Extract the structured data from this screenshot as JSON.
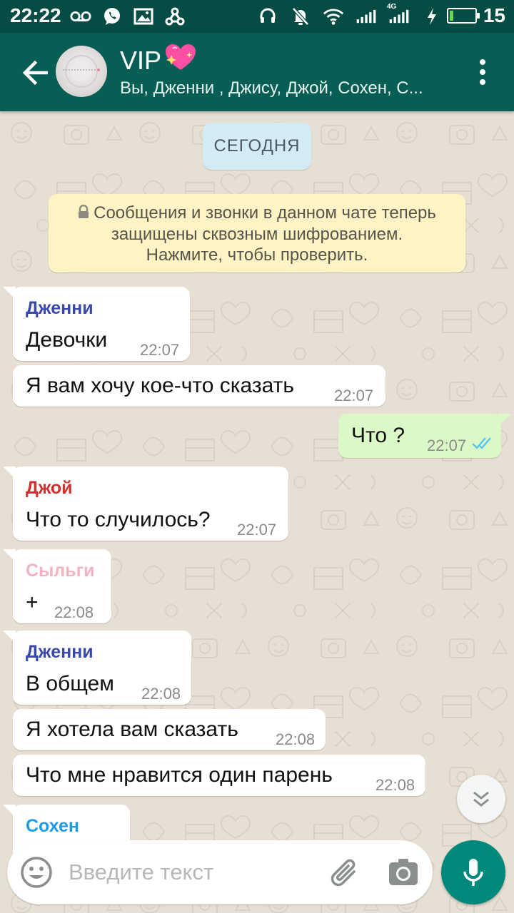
{
  "status_bar": {
    "time": "22:22",
    "battery": "15",
    "battery_level": 0.15,
    "icons_left": [
      "voicemail-icon",
      "whatsapp-icon",
      "gallery-icon",
      "share-network-icon"
    ],
    "icons_right": [
      "headset-icon",
      "notifications-off-icon",
      "wifi-icon",
      "signal-icon",
      "signal-4g-icon",
      "charging-icon"
    ],
    "network_label": "4G"
  },
  "header": {
    "title": "VIP",
    "title_emoji": "💖",
    "subtitle": "Вы, Дженни , Джису, Джой, Сохен, С...",
    "back_icon": "arrow-left-icon",
    "menu_icon": "more-vert-icon"
  },
  "chat": {
    "date_chip": "СЕГОДНЯ",
    "encryption_notice": {
      "line1": "Сообщения и звонки в данном чате теперь",
      "line2": "защищены сквозным шифрованием.",
      "line3": "Нажмите, чтобы проверить."
    },
    "messages": [
      {
        "sender": "Дженни",
        "sender_color": "#3949ab",
        "text": "Девочки",
        "time": "22:07",
        "direction": "in"
      },
      {
        "sender": "",
        "text": "Я вам хочу кое-что сказать",
        "time": "22:07",
        "direction": "in"
      },
      {
        "sender": "",
        "text": "Что ?",
        "time": "22:07",
        "direction": "out",
        "status": "read"
      },
      {
        "sender": "Джой",
        "sender_color": "#d32f2f",
        "text": "Что то случилось?",
        "time": "22:07",
        "direction": "in"
      },
      {
        "sender": "Сыльги",
        "sender_color": "#f4b3c2",
        "text": "+",
        "time": "22:08",
        "direction": "in"
      },
      {
        "sender": "Дженни",
        "sender_color": "#3949ab",
        "text": "В общем",
        "time": "22:08",
        "direction": "in"
      },
      {
        "sender": "",
        "text": "Я хотела вам сказать",
        "time": "22:08",
        "direction": "in"
      },
      {
        "sender": "",
        "text": "Что мне нравится один парень",
        "time": "22:08",
        "direction": "in"
      },
      {
        "sender": "Сохен",
        "sender_color": "#1e9be6",
        "text": "",
        "time": "",
        "direction": "in"
      }
    ]
  },
  "input": {
    "placeholder": "Введите текст"
  },
  "colors": {
    "header": "#075e54",
    "status_bar": "#054d44",
    "outgoing_bubble": "#dcf8c6",
    "incoming_bubble": "#ffffff",
    "read_ticks": "#4fc3f7",
    "mic_button": "#00897b"
  }
}
